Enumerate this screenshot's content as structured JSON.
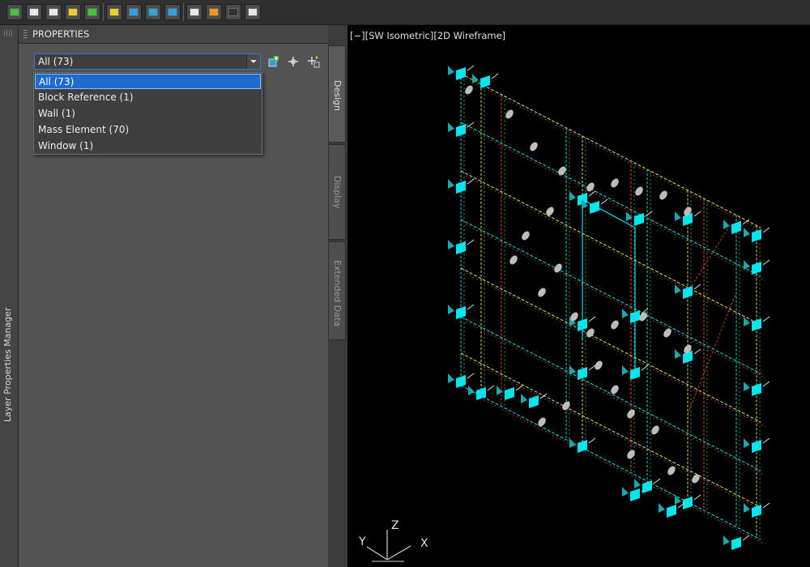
{
  "toolbar": {
    "icons": [
      "add-layer-icon",
      "refresh-icon",
      "zoom-icon",
      "edit-text-icon",
      "check-icon",
      "properties-icon",
      "layer-states-icon",
      "layer-filter-icon",
      "layer-manager-icon",
      "edit-icon",
      "export-icon",
      "display-icon",
      "settings-icon"
    ]
  },
  "left_strip": {
    "label": "Layer Properties Manager"
  },
  "panel": {
    "title": "PROPERTIES",
    "select": {
      "value": "All (73)"
    },
    "dropdown": {
      "options": [
        "All (73)",
        "Block Reference (1)",
        "Wall (1)",
        "Mass Element (70)",
        "Window (1)"
      ],
      "selected_index": 0
    }
  },
  "tabs": [
    {
      "label": "Design",
      "active": true
    },
    {
      "label": "Display",
      "active": false
    },
    {
      "label": "Extended Data",
      "active": false
    }
  ],
  "viewport": {
    "label": "[−][SW Isometric][2D Wireframe]",
    "axis": {
      "x": "X",
      "y": "Y",
      "z": "Z"
    }
  },
  "colors": {
    "accent": "#1e6cd0",
    "wire_cyan": "#00e5ee",
    "wire_yellow": "#d7e56b",
    "wire_red": "#e04a3a",
    "wire_green": "#49c53b"
  }
}
